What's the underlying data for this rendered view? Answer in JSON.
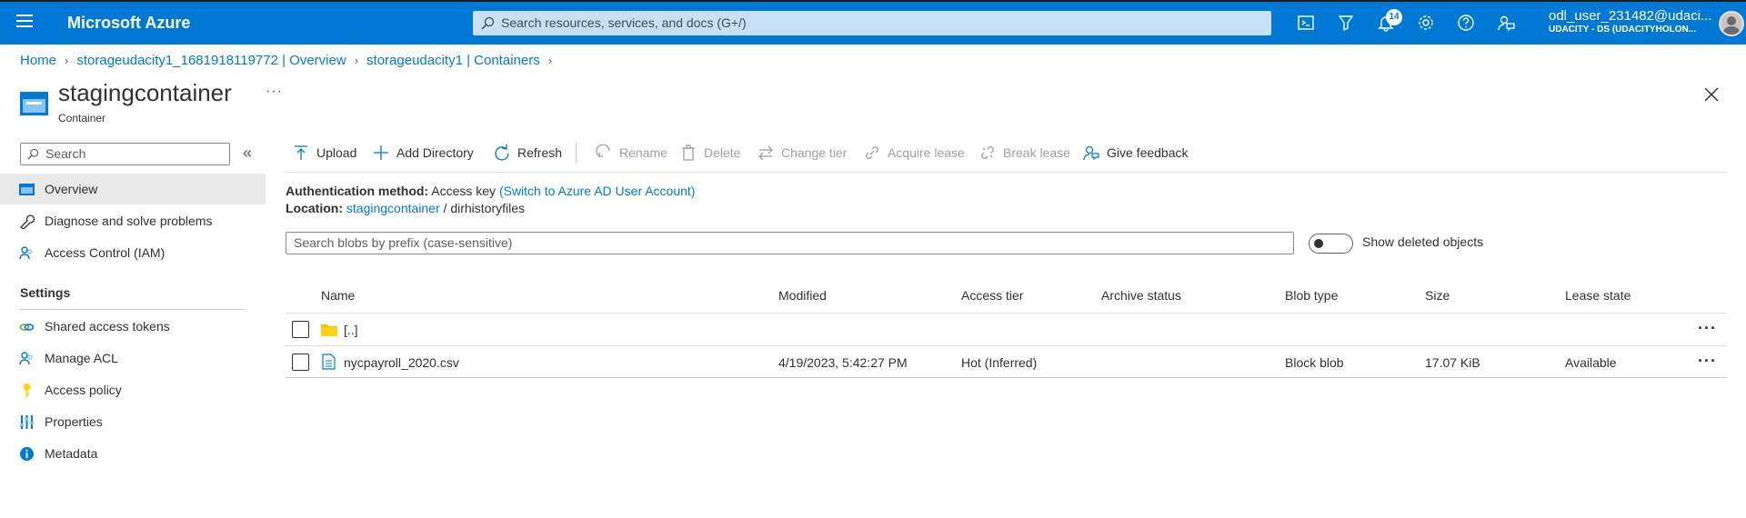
{
  "topbar": {
    "brand": "Microsoft Azure",
    "search_placeholder": "Search resources, services, and docs (G+/)",
    "notification_count": "14",
    "user_name": "odl_user_231482@udaci...",
    "user_tenant": "UDACITY - DS (UDACITYHOLON..."
  },
  "breadcrumb": {
    "items": [
      "Home",
      "storageudacity1_1681918119772 | Overview",
      "storageudacity1 | Containers"
    ]
  },
  "header": {
    "title": "stagingcontainer",
    "subtitle": "Container",
    "more": "···"
  },
  "sidebar": {
    "search_placeholder": "Search",
    "collapse": "«",
    "items": [
      {
        "label": "Overview",
        "icon": "overview-icon"
      },
      {
        "label": "Diagnose and solve problems",
        "icon": "wrench-icon"
      },
      {
        "label": "Access Control (IAM)",
        "icon": "people-icon"
      }
    ],
    "settings_heading": "Settings",
    "settings_items": [
      {
        "label": "Shared access tokens",
        "icon": "link-icon"
      },
      {
        "label": "Manage ACL",
        "icon": "people-icon"
      },
      {
        "label": "Access policy",
        "icon": "key-icon"
      },
      {
        "label": "Properties",
        "icon": "properties-icon"
      },
      {
        "label": "Metadata",
        "icon": "info-icon"
      }
    ]
  },
  "toolbar": {
    "upload": "Upload",
    "add_directory": "Add Directory",
    "refresh": "Refresh",
    "rename": "Rename",
    "delete": "Delete",
    "change_tier": "Change tier",
    "acquire_lease": "Acquire lease",
    "break_lease": "Break lease",
    "give_feedback": "Give feedback"
  },
  "info": {
    "auth_label": "Authentication method:",
    "auth_value": "Access key",
    "auth_link": "(Switch to Azure AD User Account)",
    "location_label": "Location:",
    "location_link": "stagingcontainer",
    "location_sep": "/",
    "location_folder": "dirhistoryfiles"
  },
  "blob_search": {
    "placeholder": "Search blobs by prefix (case-sensitive)",
    "toggle_label": "Show deleted objects",
    "toggle_on": false
  },
  "table": {
    "columns": [
      "Name",
      "Modified",
      "Access tier",
      "Archive status",
      "Blob type",
      "Size",
      "Lease state"
    ],
    "rows": [
      {
        "name": "[..]",
        "type": "folder",
        "modified": "",
        "access_tier": "",
        "archive_status": "",
        "blob_type": "",
        "size": "",
        "lease_state": "",
        "more": "···"
      },
      {
        "name": "nycpayroll_2020.csv",
        "type": "file",
        "modified": "4/19/2023, 5:42:27 PM",
        "access_tier": "Hot (Inferred)",
        "archive_status": "",
        "blob_type": "Block blob",
        "size": "17.07 KiB",
        "lease_state": "Available",
        "more": "···"
      }
    ]
  },
  "colors": {
    "topbar": "#0078d4",
    "link": "#0078d4",
    "active_nav": "#e9e9e9"
  }
}
